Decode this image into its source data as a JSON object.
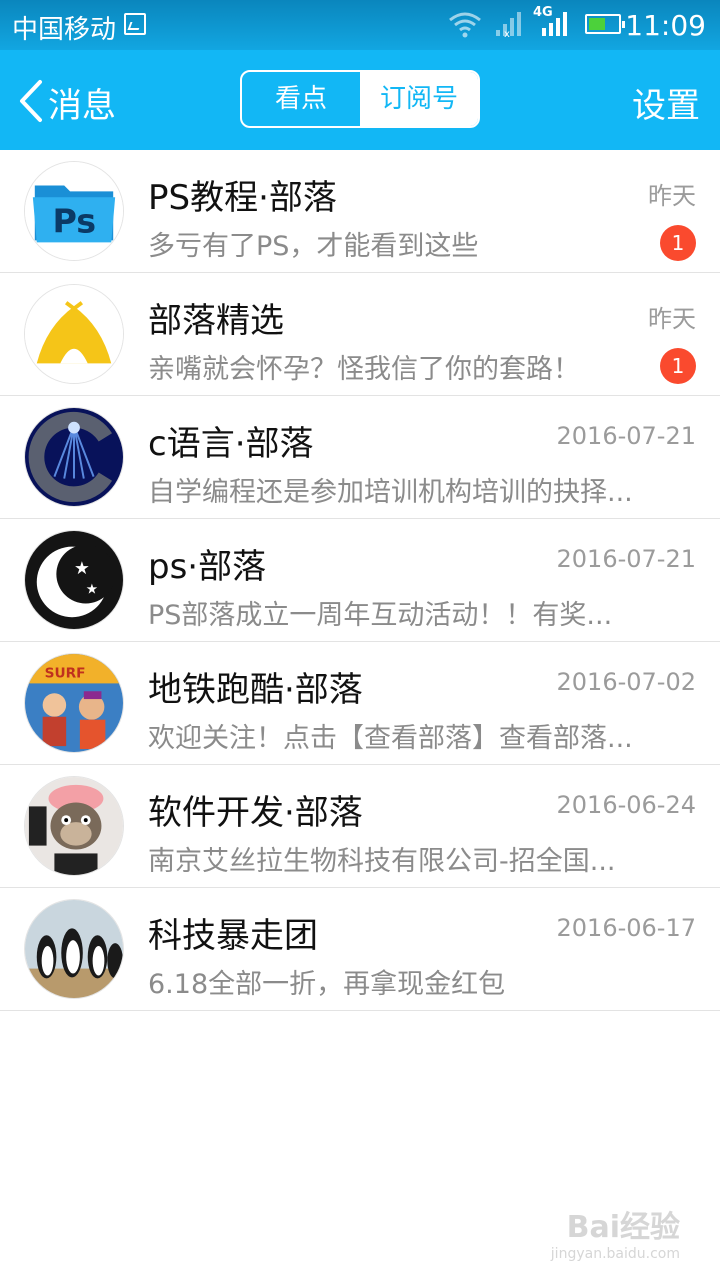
{
  "status_bar": {
    "carrier": "中国移动",
    "network": "4G",
    "time": "11:09"
  },
  "nav": {
    "back_label": "消息",
    "tabs": [
      "看点",
      "订阅号"
    ],
    "active_tab": "订阅号",
    "settings_label": "设置"
  },
  "colors": {
    "accent": "#12b7f5",
    "badge": "#fa4a2e"
  },
  "items": [
    {
      "name": "PS教程·部落",
      "date": "昨天",
      "message": "多亏有了PS，才能看到这些",
      "unread": "1",
      "avatar": "ps-folder-avatar"
    },
    {
      "name": "部落精选",
      "date": "昨天",
      "message": "亲嘴就会怀孕？怪我信了你的套路！",
      "unread": "1",
      "avatar": "tent-avatar"
    },
    {
      "name": "c语言·部落",
      "date": "2016-07-21",
      "message": "自学编程还是参加培训机构培训的抉择...",
      "avatar": "c-logo-avatar"
    },
    {
      "name": "ps·部落",
      "date": "2016-07-21",
      "message": "PS部落成立一周年互动活动！！有奖...",
      "avatar": "moon-stars-avatar"
    },
    {
      "name": "地铁跑酷·部落",
      "date": "2016-07-02",
      "message": "欢迎关注！点击【查看部落】查看部落...",
      "avatar": "subway-surfers-avatar"
    },
    {
      "name": "软件开发·部落",
      "date": "2016-06-24",
      "message": "南京艾丝拉生物科技有限公司-招全国...",
      "avatar": "monkey-avatar"
    },
    {
      "name": "科技暴走团",
      "date": "2016-06-17",
      "message": "6.18全部一折，再拿现金红包",
      "avatar": "penguins-avatar"
    }
  ],
  "watermark": {
    "line1": "Bai经验",
    "line2": "jingyan.baidu.com"
  }
}
